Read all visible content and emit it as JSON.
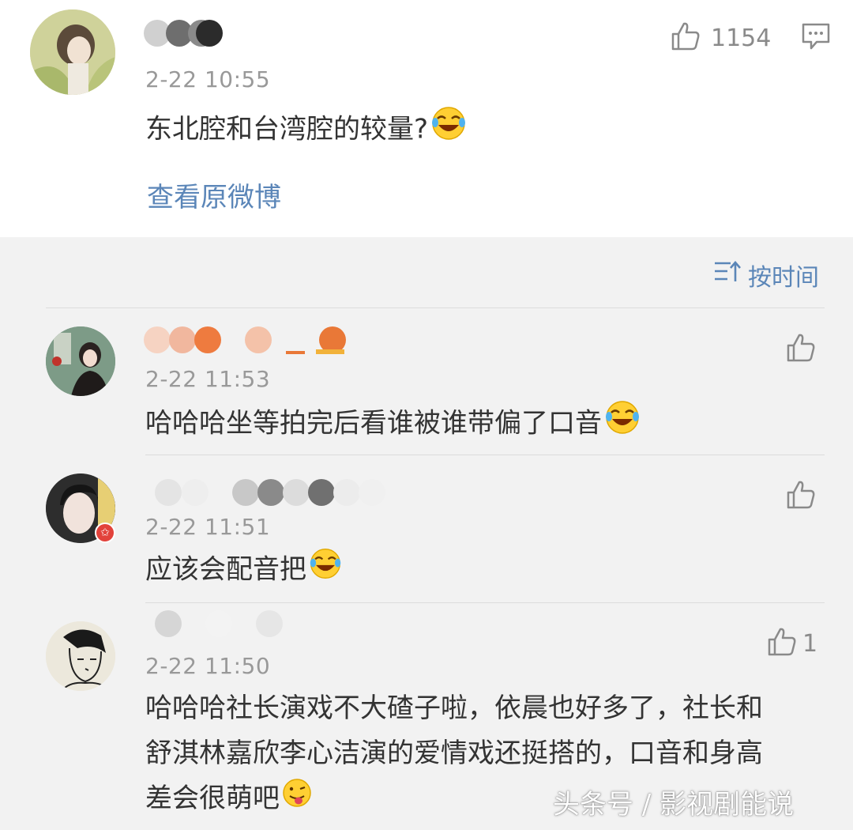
{
  "post": {
    "date": "2-22 10:55",
    "text": "东北腔和台湾腔的较量?",
    "like_count": "1154",
    "view_original": "查看原微博"
  },
  "sort_label": "按时间",
  "comments": [
    {
      "date": "2-22 11:53",
      "text": "哈哈哈坐等拍完后看谁被谁带偏了口音",
      "like_count": ""
    },
    {
      "date": "2-22 11:51",
      "text": "应该会配音把",
      "like_count": ""
    },
    {
      "date": "2-22 11:50",
      "text_lines": [
        "哈哈哈社长演戏不大碴子啦，依晨也好多了，社长和",
        "舒淇林嘉欣李心洁演的爱情戏还挺搭的，口音和身高",
        "差会很萌吧"
      ],
      "like_count": "1"
    }
  ],
  "watermark": "头条号 / 影视剧能说",
  "colors": {
    "link": "#5b86b8",
    "date": "#999999",
    "text": "#333333",
    "background": "#f2f2f2"
  },
  "icons": [
    "thumbs-up-icon",
    "comment-icon",
    "sort-icon",
    "laughing-emoji",
    "tongue-emoji"
  ]
}
